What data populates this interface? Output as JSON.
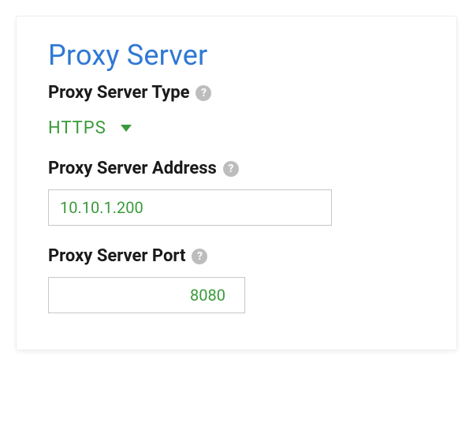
{
  "section": {
    "title": "Proxy Server"
  },
  "fields": {
    "type": {
      "label": "Proxy Server Type",
      "value": "HTTPS"
    },
    "address": {
      "label": "Proxy Server Address",
      "value": "10.10.1.200"
    },
    "port": {
      "label": "Proxy Server Port",
      "value": "8080"
    }
  },
  "icons": {
    "help_glyph": "?"
  }
}
